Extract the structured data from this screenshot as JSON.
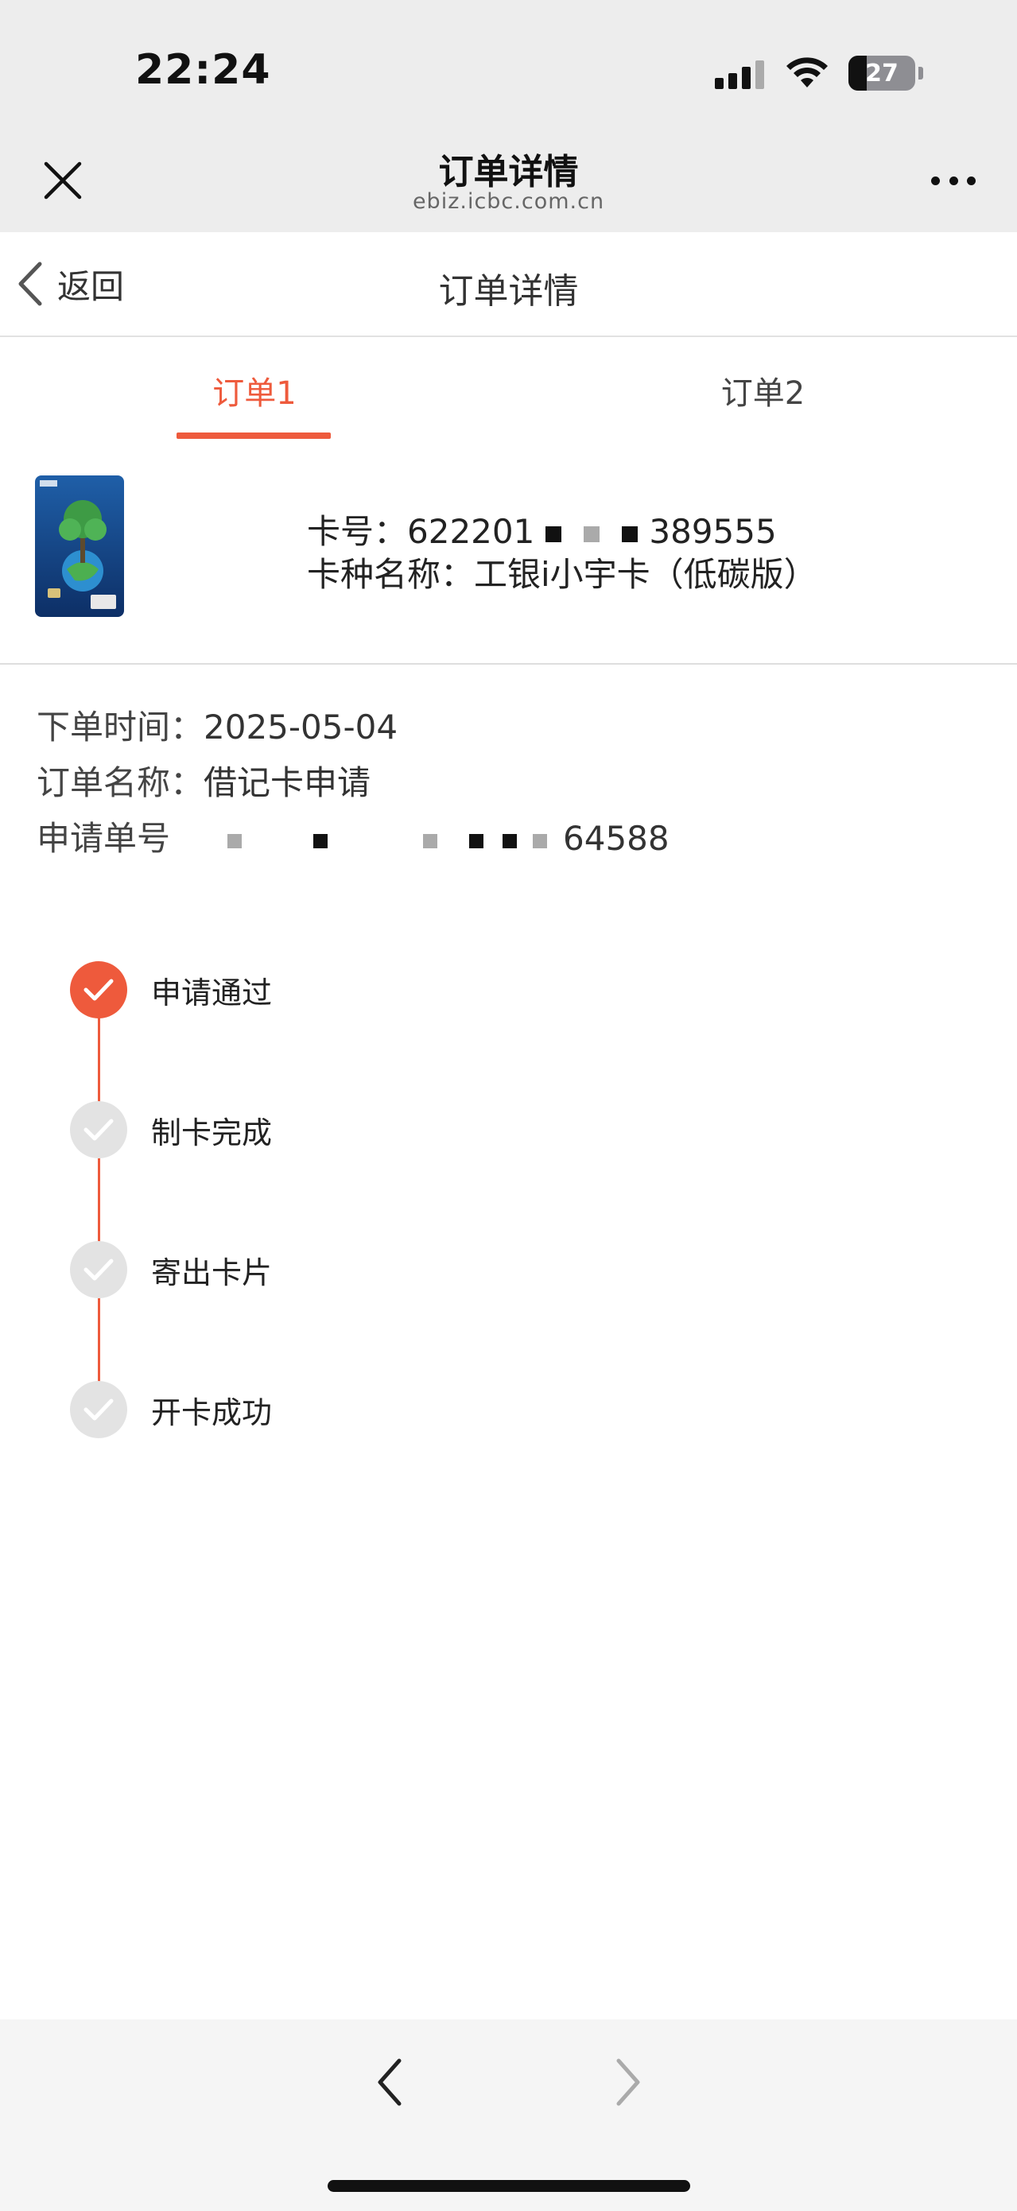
{
  "status_bar": {
    "time": "22:24",
    "battery": "27",
    "icons": [
      "signal-icon",
      "wifi-icon",
      "battery-icon"
    ]
  },
  "browser": {
    "title": "订单详情",
    "domain": "ebiz.icbc.com.cn",
    "icons": [
      "close-icon",
      "more-icon"
    ]
  },
  "page_header": {
    "back_label": "返回",
    "title": "订单详情"
  },
  "tabs": [
    {
      "label": "订单1",
      "active": true
    },
    {
      "label": "订单2",
      "active": false
    }
  ],
  "card": {
    "number_label": "卡号：",
    "number_start": "622201",
    "number_end": "389555",
    "type_label": "卡种名称：",
    "type_name": "工银i小宇卡（低碳版）"
  },
  "order": {
    "time_label": "下单时间：",
    "time_value": "2025-05-04",
    "name_label": "订单名称：",
    "name_value": "借记卡申请",
    "number_label": "申请单号",
    "number_end": "64588"
  },
  "timeline": [
    {
      "label": "申请通过",
      "done": true
    },
    {
      "label": "制卡完成",
      "done": false
    },
    {
      "label": "寄出卡片",
      "done": false
    },
    {
      "label": "开卡成功",
      "done": false
    }
  ],
  "colors": {
    "accent": "#ee5a3c",
    "inactive_step": "#e3e3e3",
    "header_bg": "#ededed"
  },
  "bottom_nav": {
    "icons": [
      "chevron-left-icon",
      "chevron-right-icon"
    ]
  }
}
